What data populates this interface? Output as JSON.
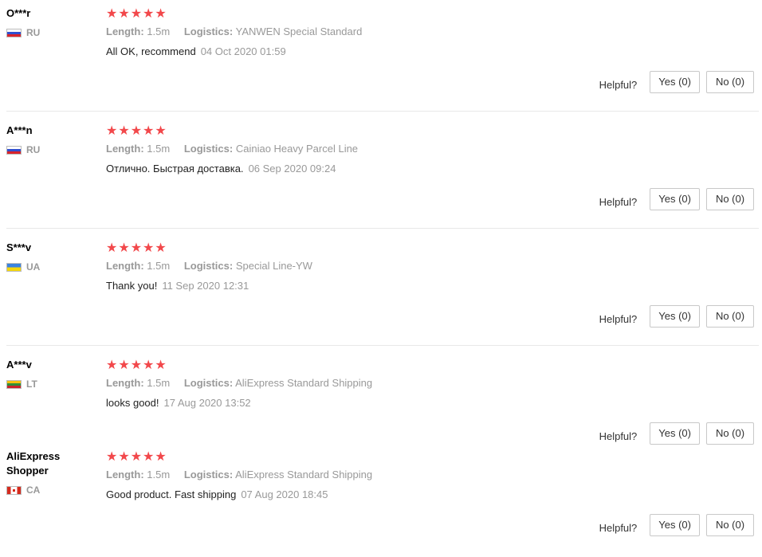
{
  "reviews": [
    {
      "username": "O***r",
      "country": "RU",
      "stars": "★★★★★",
      "length_label": "Length:",
      "length_value": "1.5m",
      "logistics_label": "Logistics:",
      "logistics_value": "YANWEN Special Standard",
      "text": "All OK, recommend",
      "date": "04 Oct 2020 01:59",
      "helpful_label": "Helpful?",
      "yes": "Yes (0)",
      "no": "No (0)"
    },
    {
      "username": "A***n",
      "country": "RU",
      "stars": "★★★★★",
      "length_label": "Length:",
      "length_value": "1.5m",
      "logistics_label": "Logistics:",
      "logistics_value": "Cainiao Heavy Parcel Line",
      "text": "Отлично. Быстрая доставка.",
      "date": "06 Sep 2020 09:24",
      "helpful_label": "Helpful?",
      "yes": "Yes (0)",
      "no": "No (0)"
    },
    {
      "username": "S***v",
      "country": "UA",
      "stars": "★★★★★",
      "length_label": "Length:",
      "length_value": "1.5m",
      "logistics_label": "Logistics:",
      "logistics_value": "Special Line-YW",
      "text": "Thank you!",
      "date": "11 Sep 2020 12:31",
      "helpful_label": "Helpful?",
      "yes": "Yes (0)",
      "no": "No (0)"
    },
    {
      "username": "A***v",
      "country": "LT",
      "stars": "★★★★★",
      "length_label": "Length:",
      "length_value": "1.5m",
      "logistics_label": "Logistics:",
      "logistics_value": "AliExpress Standard Shipping",
      "text": "looks good!",
      "date": "17 Aug 2020 13:52",
      "helpful_label": "Helpful?",
      "yes": "Yes (0)",
      "no": "No (0)"
    },
    {
      "username": "AliExpress Shopper",
      "country": "CA",
      "stars": "★★★★★",
      "length_label": "Length:",
      "length_value": "1.5m",
      "logistics_label": "Logistics:",
      "logistics_value": "AliExpress Standard Shipping",
      "text": "Good product. Fast shipping",
      "date": "07 Aug 2020 18:45",
      "helpful_label": "Helpful?",
      "yes": "Yes (0)",
      "no": "No (0)"
    }
  ],
  "colors": {
    "star": "#f2484b",
    "muted": "#999999",
    "divider": "#e8e8e8"
  },
  "icons": {
    "flag_ru": "russia-flag-icon",
    "flag_ua": "ukraine-flag-icon",
    "flag_lt": "lithuania-flag-icon",
    "flag_ca": "canada-flag-icon"
  }
}
